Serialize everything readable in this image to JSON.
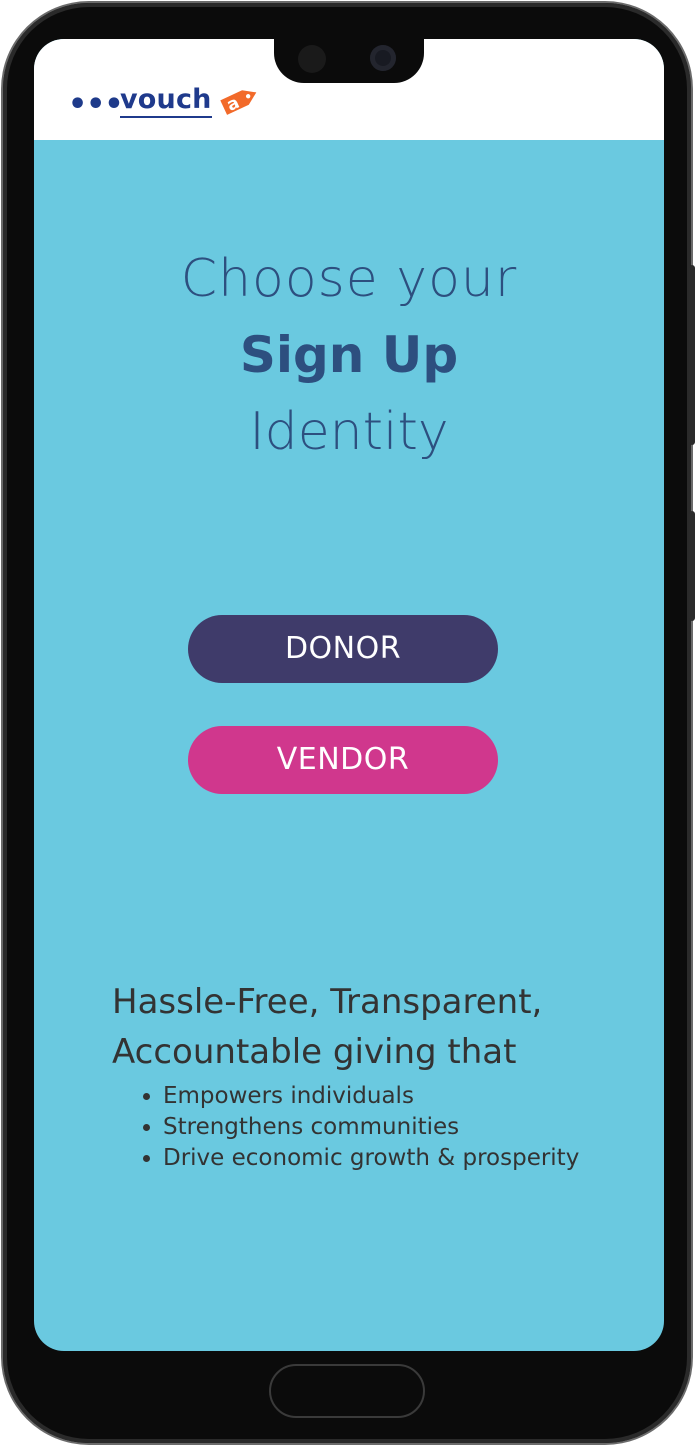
{
  "header": {
    "menu_icon": "ellipsis-icon",
    "logo_text": "vouch",
    "logo_tag_letter": "a",
    "brand_color": "#1f3a8c",
    "tag_color": "#f26a2a"
  },
  "main": {
    "heading_line1": "Choose your",
    "heading_line2": "Sign Up",
    "heading_line3": "Identity",
    "donor_button": "DONOR",
    "vendor_button": "VENDOR",
    "donor_color": "#3f3b6a",
    "vendor_color": "#d0378d",
    "background_color": "#6ac9e0"
  },
  "footer": {
    "tagline": "Hassle-Free, Transparent, Accountable giving that",
    "bullets": [
      "Empowers individuals",
      "Strengthens communities",
      "Drive economic growth & prosperity"
    ]
  }
}
